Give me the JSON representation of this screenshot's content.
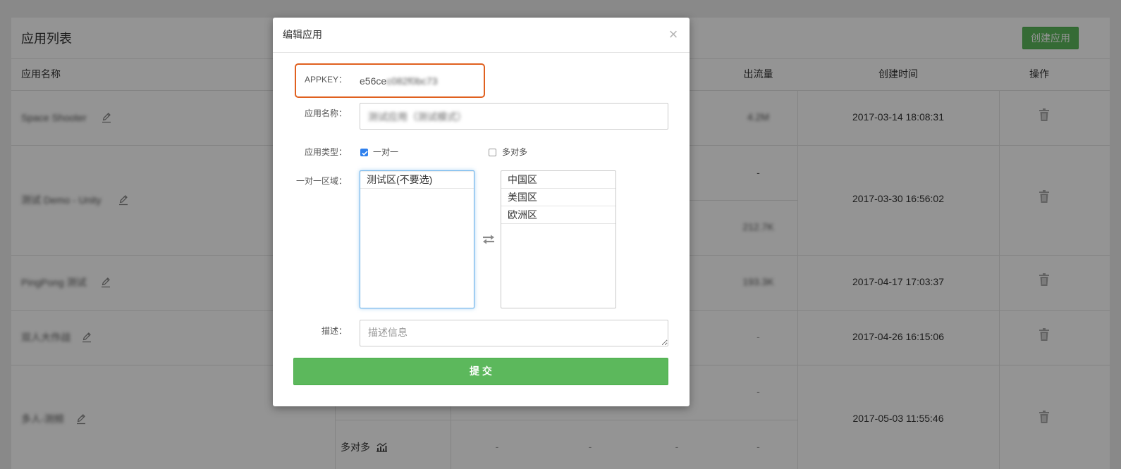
{
  "page": {
    "title": "应用列表",
    "create_button_label": "创建应用",
    "headers": {
      "name": "应用名称",
      "out_traffic": "出流量",
      "created_at": "创建时间",
      "actions": "操作"
    },
    "rows": [
      {
        "name": "Space Shooter",
        "out_traffic": "4.2M",
        "created_at": "2017-03-14 18:08:31"
      },
      {
        "name": "测试 Demo - Unity",
        "out_traffic_top": "-",
        "out_traffic": "212.7K",
        "created_at": "2017-03-30 16:56:02"
      },
      {
        "name": "PingPong 测试",
        "out_traffic": "193.3K",
        "created_at": "2017-04-17 17:03:37"
      },
      {
        "name": "双人大作战",
        "out_traffic": "-",
        "created_at": "2017-04-26 16:15:06"
      },
      {
        "name": "多人-测频",
        "out_traffic_top": "-",
        "created_at": "2017-05-03 11:55:46",
        "sub_row": {
          "type": "多对多",
          "values": [
            "-",
            "-",
            "-",
            "-"
          ]
        }
      }
    ]
  },
  "modal": {
    "title": "编辑应用",
    "close_label": "×",
    "appkey": {
      "label": "APPKEY：",
      "value": "e56ce",
      "masked_value": "c082f0bc73"
    },
    "app_name": {
      "label": "应用名称：",
      "value": "测试应用（测试模式）"
    },
    "app_type": {
      "label": "应用类型：",
      "options": [
        {
          "label": "一对一",
          "checked": true
        },
        {
          "label": "多对多",
          "checked": false
        }
      ]
    },
    "region": {
      "label": "一对一区域：",
      "selected": [
        "测试区(不要选)"
      ],
      "available": [
        "中国区",
        "美国区",
        "欧洲区"
      ]
    },
    "description": {
      "label": "描述：",
      "placeholder": "描述信息",
      "value": ""
    },
    "submit_label": "提 交"
  },
  "icons": {
    "edit": "pencil-icon",
    "delete": "trash-icon",
    "close": "close-icon",
    "swap": "swap-arrows-icon",
    "chart": "line-chart-icon",
    "check": "check-icon"
  },
  "colors": {
    "brand_green": "#5cb85c",
    "highlight_orange": "#e0601f",
    "checkbox_blue": "#2f80ed",
    "focus_blue": "#66afe9",
    "backdrop": "rgba(0,0,0,0.42)"
  }
}
